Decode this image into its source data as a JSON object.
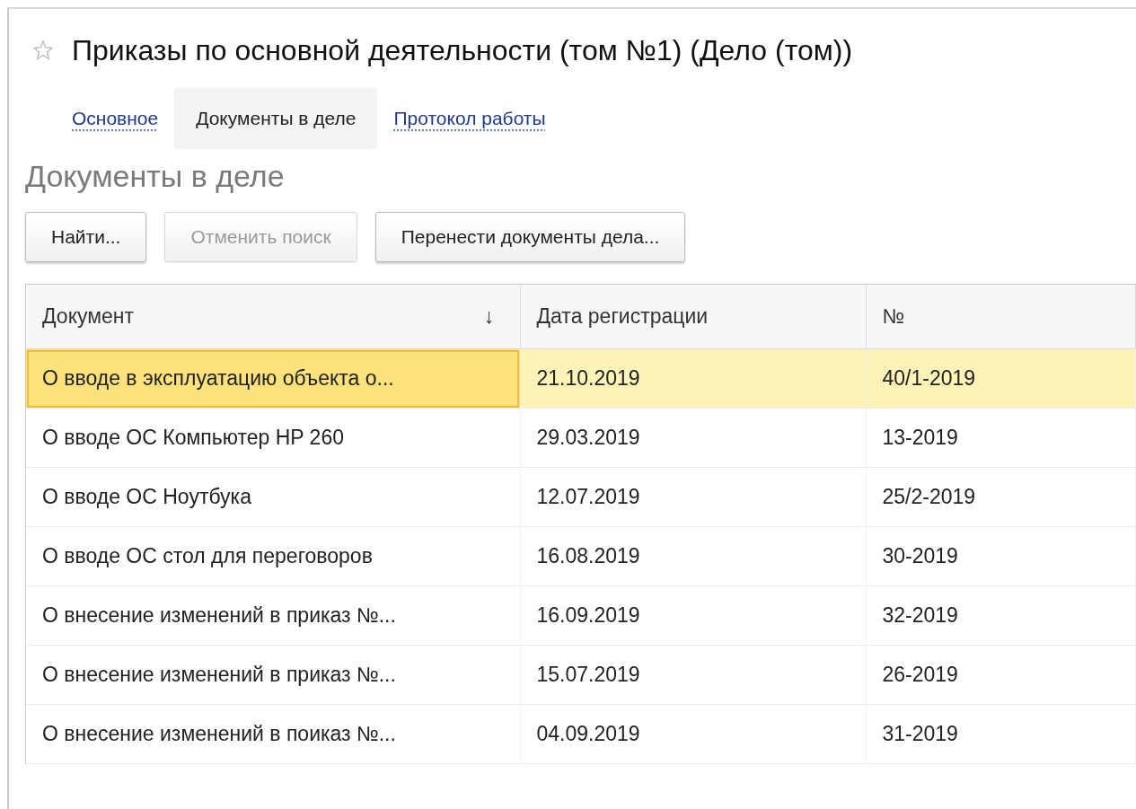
{
  "window": {
    "title": "Приказы по основной деятельности (том №1) (Дело (том))",
    "favorite": false
  },
  "tabs": [
    {
      "label": "Основное",
      "selected": false
    },
    {
      "label": "Документы в деле",
      "selected": true
    },
    {
      "label": "Протокол работы",
      "selected": false
    }
  ],
  "section": {
    "title": "Документы в деле"
  },
  "buttons": [
    {
      "label": "Найти...",
      "disabled": false
    },
    {
      "label": "Отменить поиск",
      "disabled": true
    },
    {
      "label": "Перенести документы дела...",
      "disabled": false
    }
  ],
  "table": {
    "columns": [
      {
        "label": "Документ",
        "sort_indicator": "↓"
      },
      {
        "label": "Дата регистрации"
      },
      {
        "label": "№"
      }
    ],
    "rows": [
      {
        "cells": [
          "О вводе в эксплуатацию объекта о...",
          "21.10.2019",
          "40/1-2019"
        ],
        "selected": true
      },
      {
        "cells": [
          "О вводе ОС Компьютер HP 260",
          "29.03.2019",
          "13-2019"
        ],
        "selected": false
      },
      {
        "cells": [
          "О вводе ОС Ноутбука",
          "12.07.2019",
          "25/2-2019"
        ],
        "selected": false
      },
      {
        "cells": [
          "О вводе ОС стол для переговоров",
          "16.08.2019",
          "30-2019"
        ],
        "selected": false
      },
      {
        "cells": [
          "О внесение изменений в приказ №...",
          "16.09.2019",
          "32-2019"
        ],
        "selected": false
      },
      {
        "cells": [
          "О внесение изменений в приказ №...",
          "15.07.2019",
          "26-2019"
        ],
        "selected": false
      },
      {
        "cells": [
          "О внесение изменений в поиказ №...",
          "04.09.2019",
          "31-2019"
        ],
        "selected": false
      }
    ]
  }
}
